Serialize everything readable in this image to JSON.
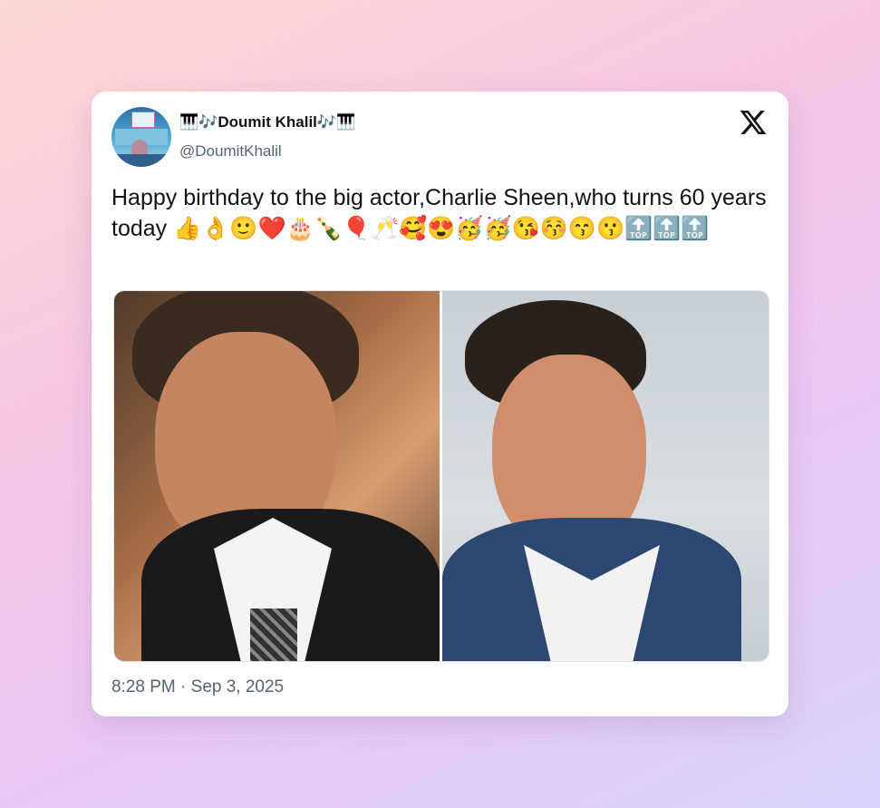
{
  "author": {
    "display_name": "🎹🎶Doumit Khalil🎶🎹",
    "handle": "@DoumitKhalil"
  },
  "tweet": {
    "text": "Happy birthday to the big actor,Charlie Sheen,who turns 60 years today 👍👌🙂❤️🎂🍾🎈🥂🥰😍🥳🥳😘😚😙😗🔝🔝🔝",
    "timestamp": "8:28 PM · Sep 3, 2025"
  },
  "media": {
    "photos": [
      {
        "alt": "photo-1"
      },
      {
        "alt": "photo-2"
      }
    ]
  },
  "icons": {
    "platform_logo": "x-logo-icon",
    "avatar": "avatar"
  },
  "colors": {
    "text_primary": "#0f1419",
    "text_secondary": "#536471",
    "card_background": "#ffffff"
  }
}
